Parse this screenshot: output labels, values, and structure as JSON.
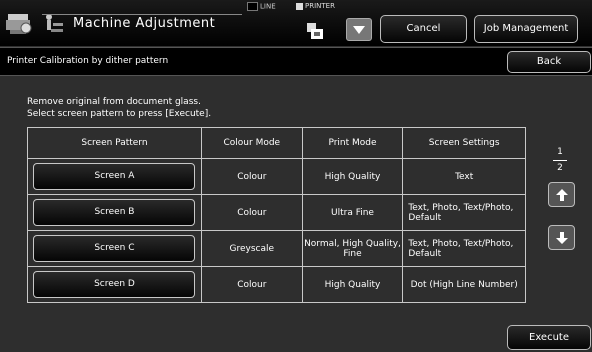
{
  "header": {
    "title": "Machine Adjustment",
    "line_label": "LINE",
    "printer_label": "PRINTER",
    "cancel_label": "Cancel",
    "job_management_label": "Job Management",
    "icons": [
      "machine-icon",
      "adjustment-icon",
      "printer-icon",
      "triangle-down-icon"
    ]
  },
  "subheader": {
    "title": "Printer Calibration by dither pattern",
    "back_label": "Back"
  },
  "instructions": {
    "line1": "Remove original from document glass.",
    "line2": "Select screen pattern to press [Execute]."
  },
  "table": {
    "headers": [
      "Screen Pattern",
      "Colour Mode",
      "Print Mode",
      "Screen Settings"
    ],
    "rows": [
      {
        "pattern": "Screen A",
        "colour_mode": "Colour",
        "print_mode": "High Quality",
        "screen_settings": "Text"
      },
      {
        "pattern": "Screen B",
        "colour_mode": "Colour",
        "print_mode": "Ultra Fine",
        "screen_settings": "Text, Photo, Text/Photo, Default"
      },
      {
        "pattern": "Screen C",
        "colour_mode": "Greyscale",
        "print_mode": "Normal, High Quality, Fine",
        "screen_settings": "Text, Photo, Text/Photo, Default"
      },
      {
        "pattern": "Screen D",
        "colour_mode": "Colour",
        "print_mode": "High Quality",
        "screen_settings": "Dot (High Line Number)"
      }
    ]
  },
  "pagination": {
    "current": "1",
    "total": "2"
  },
  "footer": {
    "execute_label": "Execute"
  }
}
